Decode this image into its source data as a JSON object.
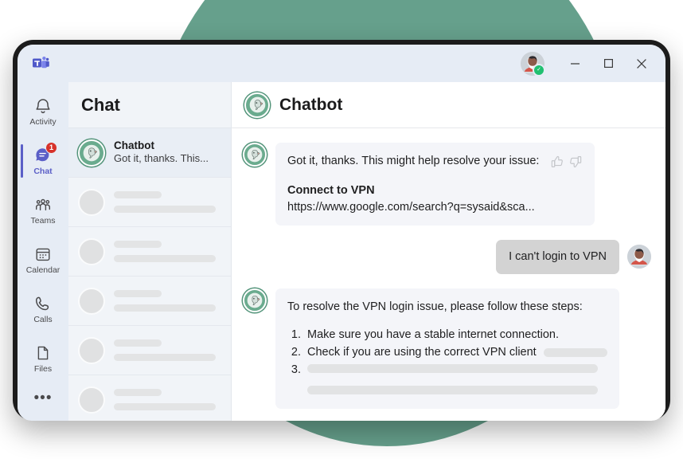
{
  "decor": {
    "blob_color": "#66a08c",
    "bezel_color": "#1c1c1c"
  },
  "titlebar": {
    "app_logo": "teams-logo",
    "presence_status": "available",
    "presence_color": "#20c070",
    "minimize_label": "─",
    "maximize_label": "□",
    "close_label": "✕"
  },
  "rail": {
    "items": [
      {
        "label": "Activity",
        "icon": "bell-icon",
        "active": false,
        "badge": null
      },
      {
        "label": "Chat",
        "icon": "chat-icon",
        "active": true,
        "badge": "1"
      },
      {
        "label": "Teams",
        "icon": "teams-icon",
        "active": false,
        "badge": null
      },
      {
        "label": "Calendar",
        "icon": "calendar-icon",
        "active": false,
        "badge": null
      },
      {
        "label": "Calls",
        "icon": "phone-icon",
        "active": false,
        "badge": null
      },
      {
        "label": "Files",
        "icon": "file-icon",
        "active": false,
        "badge": null
      }
    ],
    "more_label": "•••",
    "accent_color": "#5b5fc7",
    "badge_color": "#d7322a"
  },
  "chatlist": {
    "title": "Chat",
    "selected": {
      "name": "Chatbot",
      "preview": "Got it, thanks. This...",
      "avatar": "bot-avatar"
    },
    "placeholder_rows": 5
  },
  "conversation": {
    "header": {
      "title": "Chatbot",
      "avatar": "bot-avatar"
    },
    "messages": [
      {
        "from": "bot",
        "avatar": "bot-avatar",
        "lines": [
          {
            "text": "Got it, thanks. This might help resolve your issue:",
            "style": "normal"
          },
          {
            "text": "Connect to VPN",
            "style": "bold"
          },
          {
            "text": "https://www.google.com/search?q=sysaid&sca...",
            "style": "url"
          }
        ],
        "reactions": [
          {
            "name": "thumbs-up-icon"
          },
          {
            "name": "thumbs-down-icon"
          }
        ]
      },
      {
        "from": "user",
        "avatar": "user-avatar",
        "text": "I can't login to VPN"
      },
      {
        "from": "bot",
        "avatar": "bot-avatar",
        "intro": "To resolve the VPN login issue, please follow these steps:",
        "steps": [
          {
            "num": "1.",
            "text": "Make sure you have a stable internet connection.",
            "redacted": false
          },
          {
            "num": "2.",
            "text": "Check if you are using the correct VPN client",
            "redacted": "short"
          },
          {
            "num": "3.",
            "text": "",
            "redacted": "long"
          }
        ],
        "extra_redacted_line": true
      }
    ]
  }
}
